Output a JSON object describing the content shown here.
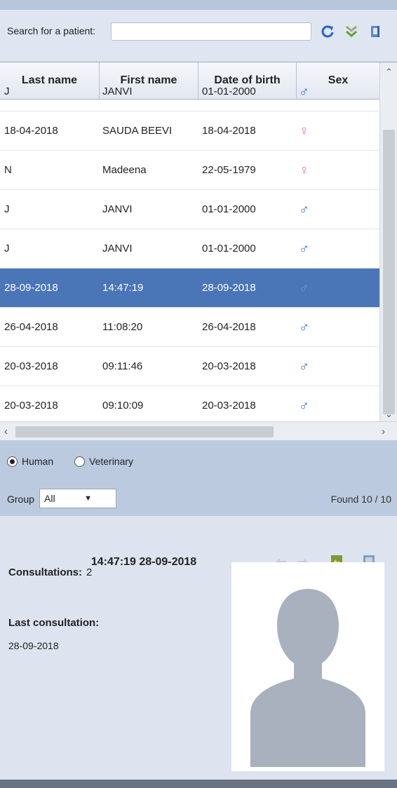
{
  "search": {
    "label": "Search for a patient:",
    "value": "",
    "placeholder": ""
  },
  "toolbar": {
    "icons": [
      "refresh-icon",
      "double-chevron-down-icon",
      "document-icon"
    ]
  },
  "table": {
    "columns": [
      "Last name",
      "First name",
      "Date of birth",
      "Sex"
    ],
    "rows": [
      {
        "last": "J",
        "first": "JANVI",
        "dob": "01-01-2000",
        "sex": "male"
      },
      {
        "last": "18-04-2018",
        "first": "SAUDA BEEVI",
        "dob": "18-04-2018",
        "sex": "female"
      },
      {
        "last": "N",
        "first": "Madeena",
        "dob": "22-05-1979",
        "sex": "female"
      },
      {
        "last": "J",
        "first": "JANVI",
        "dob": "01-01-2000",
        "sex": "male"
      },
      {
        "last": "J",
        "first": "JANVI",
        "dob": "01-01-2000",
        "sex": "male"
      },
      {
        "last": "28-09-2018",
        "first": "14:47:19",
        "dob": "28-09-2018",
        "sex": "male",
        "selected": true
      },
      {
        "last": "26-04-2018",
        "first": "11:08:20",
        "dob": "26-04-2018",
        "sex": "male"
      },
      {
        "last": "20-03-2018",
        "first": "09:11:46",
        "dob": "20-03-2018",
        "sex": "male"
      },
      {
        "last": "20-03-2018",
        "first": "09:10:09",
        "dob": "20-03-2018",
        "sex": "male"
      }
    ]
  },
  "mode": {
    "human": "Human",
    "veterinary": "Veterinary",
    "selected": "Human"
  },
  "group": {
    "label": "Group",
    "value": "All"
  },
  "found": {
    "label": "Found",
    "count": "10",
    "total": "10"
  },
  "detail": {
    "title": "14:47:19 28-09-2018",
    "consultations_label": "Consultations:",
    "consultations_value": "2",
    "last_consultation_label": "Last consultation:",
    "last_consultation_date": "28-09-2018"
  },
  "colors": {
    "selection": "#4a76b8",
    "male": "#3a6fb5",
    "female": "#d06fc0"
  }
}
